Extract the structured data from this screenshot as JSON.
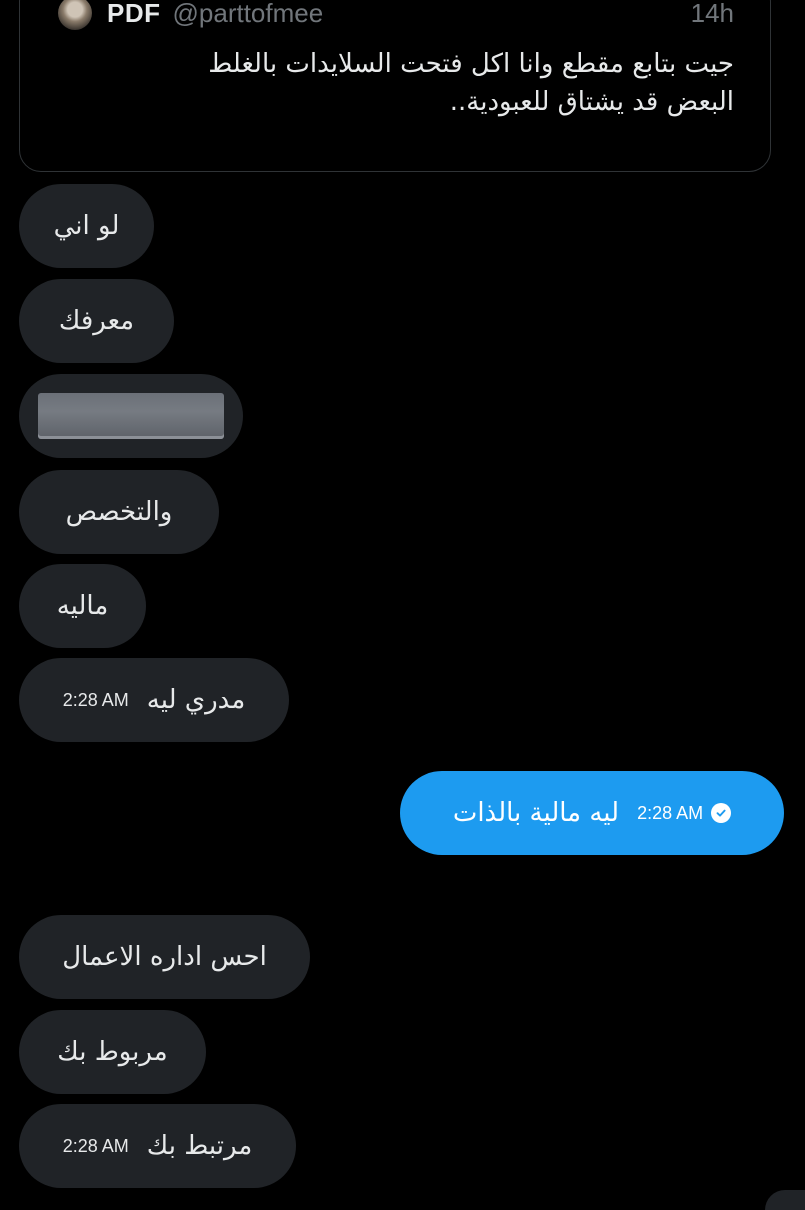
{
  "quoted_tweet": {
    "display_name": "PDF",
    "handle": "@parttofmee",
    "time": "14h",
    "text_line1": "جيت بتابع مقطع وانا اكل فتحت السلايدات بالغلط",
    "text_line2": "البعض قد يشتاق للعبودية.."
  },
  "messages": [
    {
      "direction": "in",
      "text": "لو اني"
    },
    {
      "direction": "in",
      "text": "معرفك"
    },
    {
      "direction": "in",
      "text": "",
      "redacted": true
    },
    {
      "direction": "in",
      "text": "والتخصص"
    },
    {
      "direction": "in",
      "text": "ماليه"
    },
    {
      "direction": "in",
      "text": "مدري ليه",
      "time": "2:28 AM"
    },
    {
      "direction": "out",
      "text": "ليه مالية بالذات",
      "time": "2:28 AM",
      "status": "sent-check-icon"
    },
    {
      "direction": "in",
      "text": "احس اداره الاعمال"
    },
    {
      "direction": "in",
      "text": "مربوط بك"
    },
    {
      "direction": "in",
      "text": "مرتبط بك",
      "time": "2:28 AM"
    }
  ],
  "colors": {
    "background": "#000000",
    "incoming_bubble": "#202327",
    "outgoing_bubble": "#1d9bf0",
    "muted_text": "#71767b",
    "primary_text": "#e7e9ea"
  }
}
